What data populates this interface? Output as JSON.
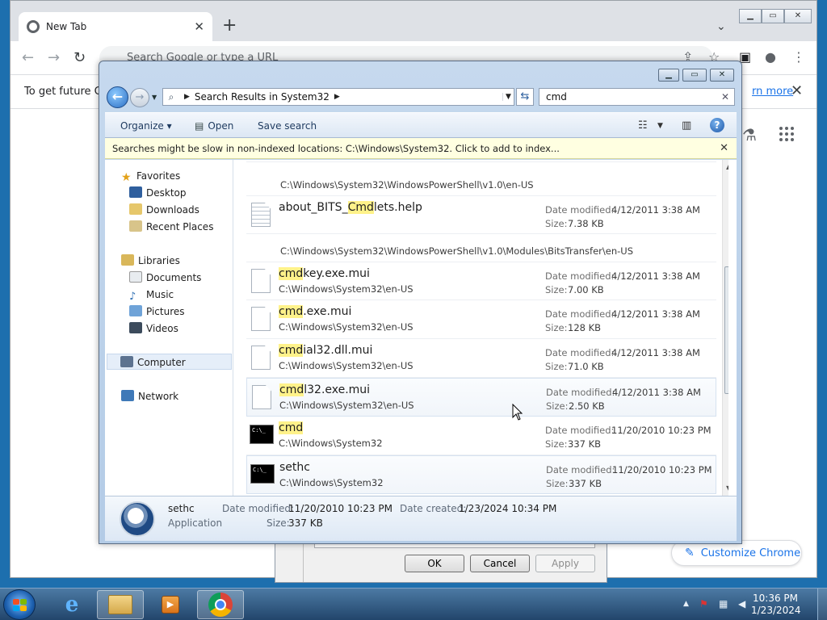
{
  "chrome": {
    "tab_title": "New Tab",
    "omnibox_placeholder": "Search Google or type a URL",
    "infobar_text": "To get future Go",
    "learn_more": "rn more",
    "customize_label": "Customize Chrome"
  },
  "explorer": {
    "breadcrumb": "Search Results in System32",
    "search_value": "cmd",
    "commands": {
      "organize": "Organize",
      "open": "Open",
      "save_search": "Save search"
    },
    "infobar": "Searches might be slow in non-indexed locations: C:\\Windows\\System32. Click to add to index...",
    "nav": {
      "favorites": "Favorites",
      "desktop": "Desktop",
      "downloads": "Downloads",
      "recent_places": "Recent Places",
      "libraries": "Libraries",
      "documents": "Documents",
      "music": "Music",
      "pictures": "Pictures",
      "videos": "Videos",
      "computer": "Computer",
      "network": "Network"
    },
    "labels": {
      "date_modified": "Date modified:",
      "size": "Size:",
      "date_created": "Date created:"
    },
    "paths": {
      "ps_enus": "C:\\Windows\\System32\\WindowsPowerShell\\v1.0\\en-US",
      "bits_enus": "C:\\Windows\\System32\\WindowsPowerShell\\v1.0\\Modules\\BitsTransfer\\en-US"
    },
    "results": [
      {
        "pre": "about_BITS_",
        "hl": "Cmd",
        "post": "lets.help",
        "path": "",
        "date": "4/12/2011 3:38 AM",
        "size": "7.38 KB"
      },
      {
        "pre": "",
        "hl": "cmd",
        "post": "key.exe.mui",
        "path": "C:\\Windows\\System32\\en-US",
        "date": "4/12/2011 3:38 AM",
        "size": "7.00 KB"
      },
      {
        "pre": "",
        "hl": "cmd",
        "post": ".exe.mui",
        "path": "C:\\Windows\\System32\\en-US",
        "date": "4/12/2011 3:38 AM",
        "size": "128 KB"
      },
      {
        "pre": "",
        "hl": "cmd",
        "post": "ial32.dll.mui",
        "path": "C:\\Windows\\System32\\en-US",
        "date": "4/12/2011 3:38 AM",
        "size": "71.0 KB"
      },
      {
        "pre": "",
        "hl": "cmd",
        "post": "l32.exe.mui",
        "path": "C:\\Windows\\System32\\en-US",
        "date": "4/12/2011 3:38 AM",
        "size": "2.50 KB"
      },
      {
        "pre": "",
        "hl": "cmd",
        "post": "",
        "path": "C:\\Windows\\System32",
        "date": "11/20/2010 10:23 PM",
        "size": "337 KB"
      },
      {
        "pre": "sethc",
        "hl": "",
        "post": "",
        "path": "C:\\Windows\\System32",
        "date": "11/20/2010 10:23 PM",
        "size": "337 KB"
      }
    ],
    "details": {
      "name": "sethc",
      "type": "Application",
      "date_modified": "11/20/2010 10:23 PM",
      "size": "337 KB",
      "date_created": "1/23/2024 10:34 PM"
    }
  },
  "properties_dialog": {
    "ok": "OK",
    "cancel": "Cancel",
    "apply": "Apply"
  },
  "taskbar": {
    "time": "10:36 PM",
    "date": "1/23/2024"
  }
}
